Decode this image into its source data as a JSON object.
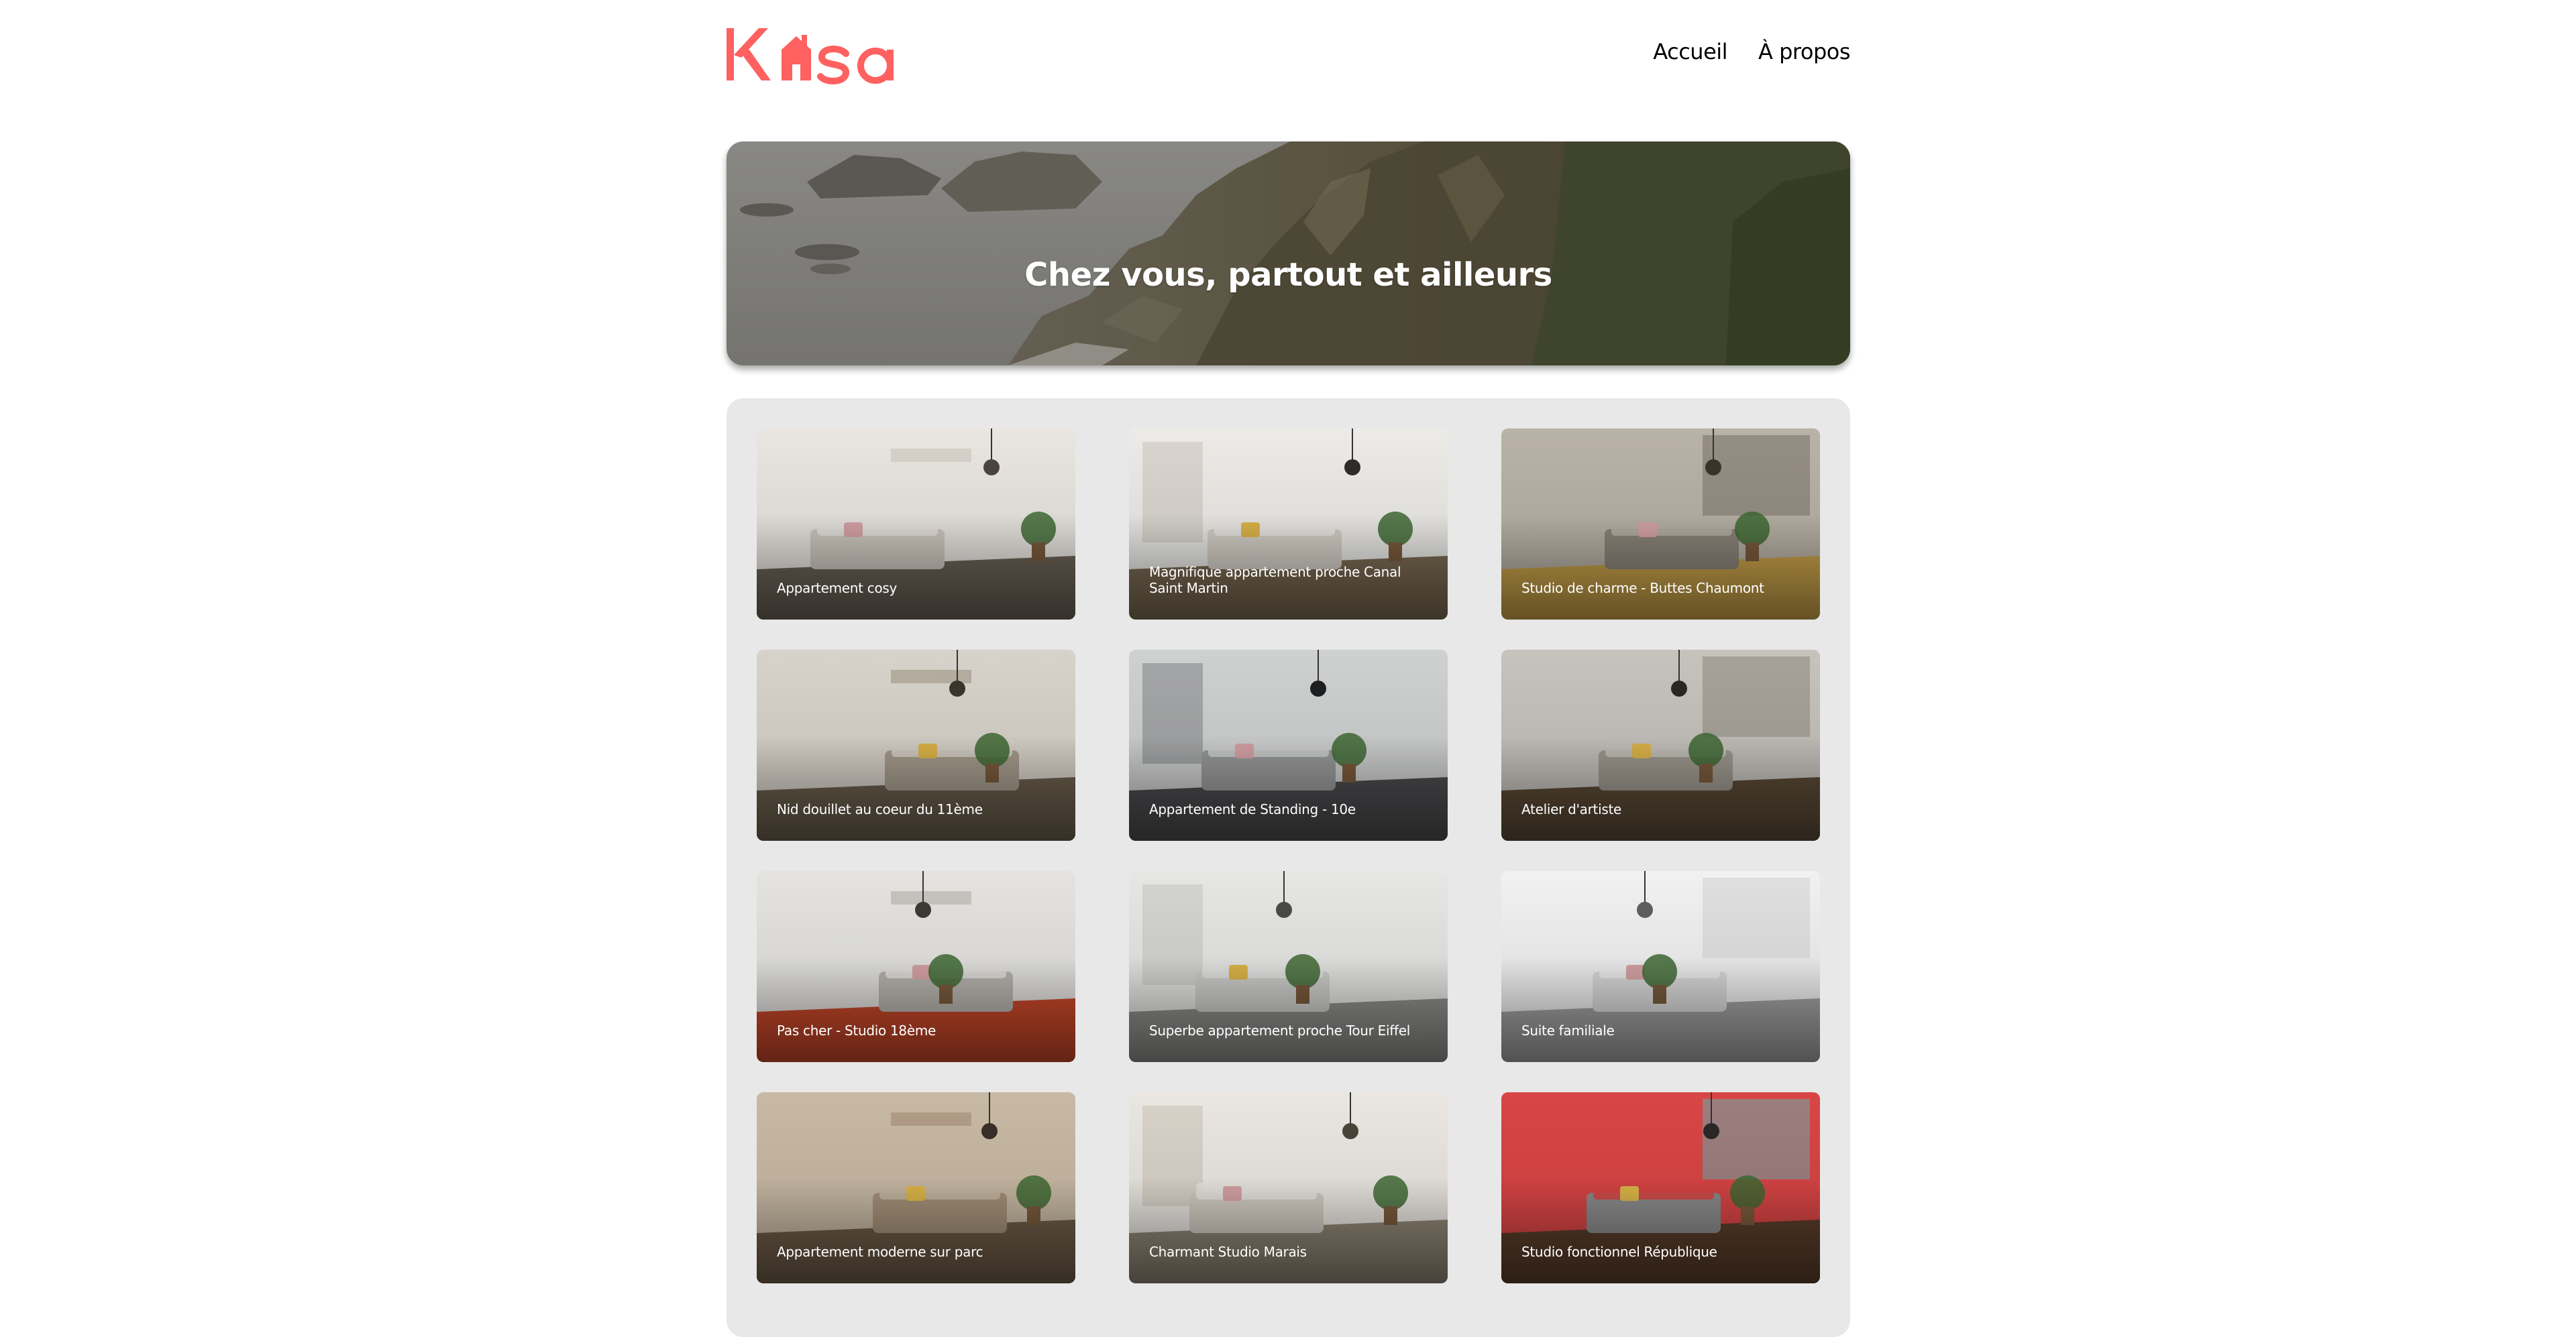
{
  "brand": {
    "name": "Kasa",
    "color": "#ff6060"
  },
  "nav": {
    "items": [
      {
        "label": "Accueil"
      },
      {
        "label": "À propos"
      }
    ]
  },
  "banner": {
    "title": "Chez vous, partout et ailleurs"
  },
  "listings": [
    {
      "title": "Appartement cosy"
    },
    {
      "title": "Magnifique appartement proche Canal Saint Martin"
    },
    {
      "title": "Studio de charme - Buttes Chaumont"
    },
    {
      "title": "Nid douillet au coeur du 11ème"
    },
    {
      "title": "Appartement de Standing - 10e"
    },
    {
      "title": "Atelier d'artiste"
    },
    {
      "title": "Pas cher - Studio 18ème"
    },
    {
      "title": "Superbe appartement proche Tour Eiffel"
    },
    {
      "title": "Suite familiale"
    },
    {
      "title": "Appartement moderne sur parc"
    },
    {
      "title": "Charmant Studio Marais"
    },
    {
      "title": "Studio fonctionnel République"
    }
  ]
}
